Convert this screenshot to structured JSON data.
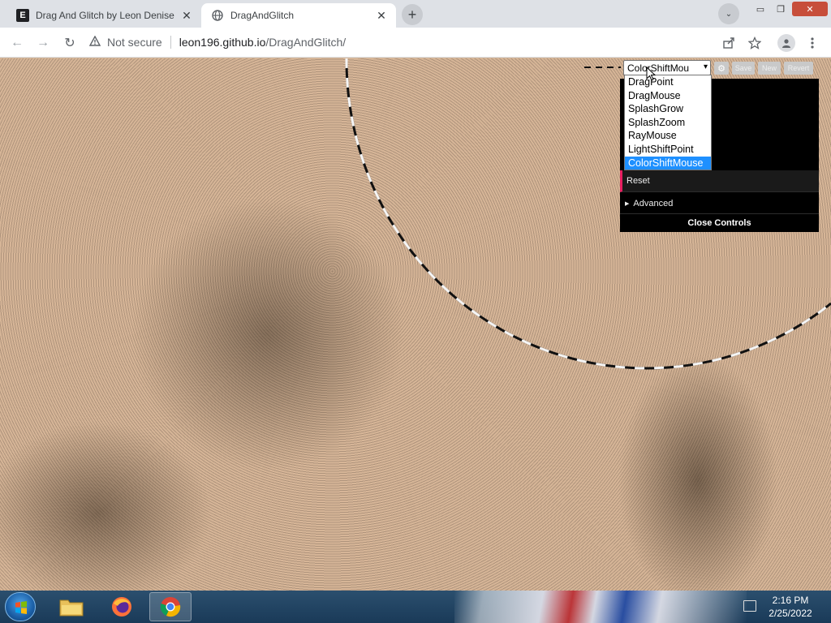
{
  "browser": {
    "tabs": [
      {
        "favicon_letter": "E",
        "title": "Drag And Glitch by Leon Denise",
        "close": "✕"
      },
      {
        "favicon_icon": "globe-icon",
        "title": "DragAndGlitch",
        "close": "✕"
      }
    ],
    "new_tab": "+",
    "tab_search": "⌄",
    "window_controls": {
      "minimize": "▭",
      "maximize": "❐",
      "close": "✕"
    },
    "nav": {
      "back": "←",
      "forward": "→",
      "reload": "↻"
    },
    "security_label": "Not secure",
    "url_host": "leon196.github.io",
    "url_path": "/DragAndGlitch/"
  },
  "gui": {
    "mode_value": "ColorShiftMou",
    "buttons": {
      "save": "Save",
      "new": "New",
      "revert": "Revert",
      "gear": "⚙"
    },
    "reset_label": "Reset",
    "advanced_label": "Advanced",
    "close_controls": "Close Controls",
    "options": [
      "DragPoint",
      "DragMouse",
      "SplashGrow",
      "SplashZoom",
      "RayMouse",
      "LightShiftPoint",
      "ColorShiftMouse"
    ],
    "selected_option": "ColorShiftMouse"
  },
  "taskbar": {
    "time": "2:16 PM",
    "date": "2/25/2022"
  },
  "colors": {
    "canvas_bg": "#d6b597",
    "accent_red": "#e61d5f",
    "selection_blue": "#1e90ff"
  }
}
